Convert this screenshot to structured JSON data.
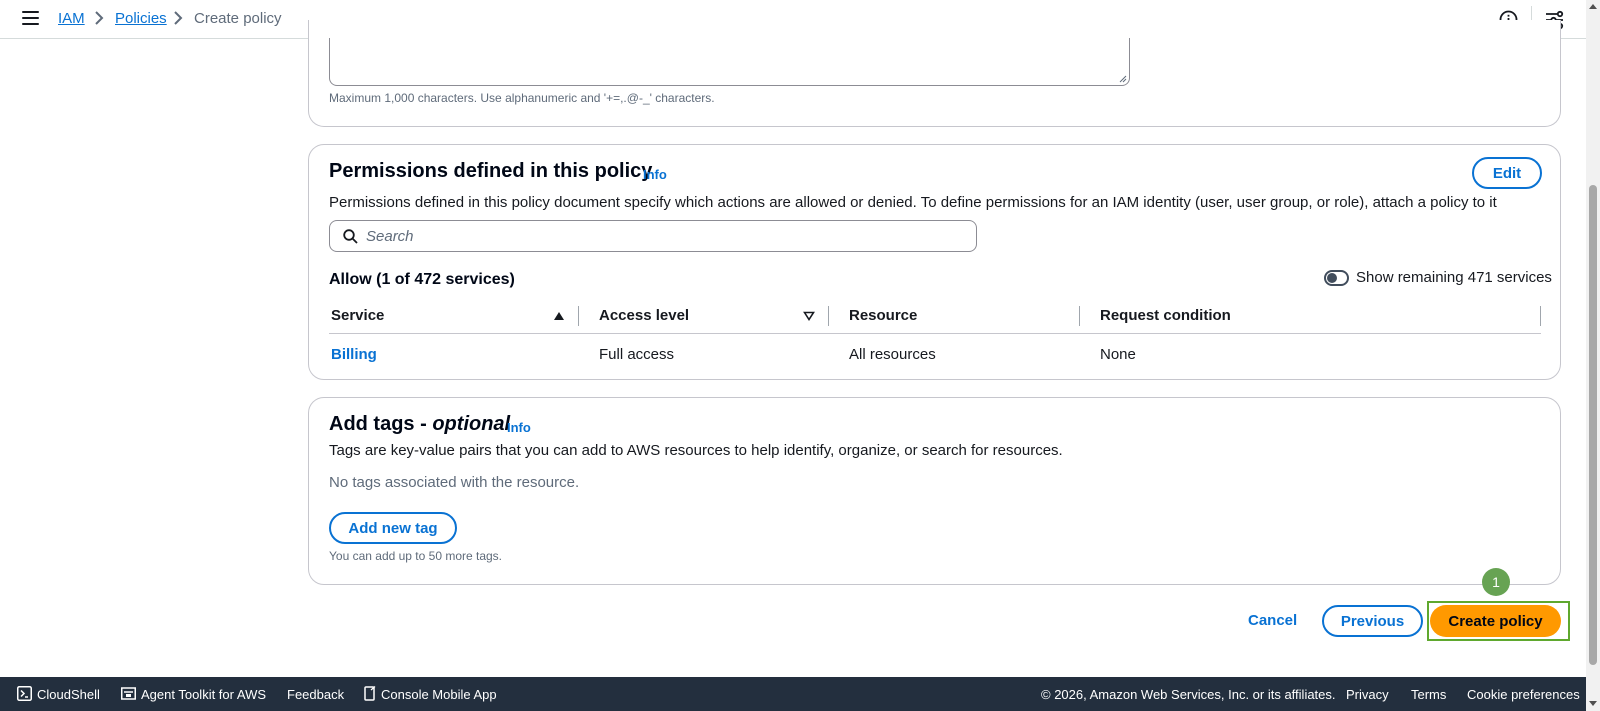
{
  "breadcrumb": {
    "items": [
      "IAM",
      "Policies"
    ],
    "current": "Create policy"
  },
  "description_card": {
    "hint": "Maximum 1,000 characters. Use alphanumeric and '+=,.@-_' characters."
  },
  "permissions": {
    "title": "Permissions defined in this policy",
    "info": "Info",
    "edit_label": "Edit",
    "description": "Permissions defined in this policy document specify which actions are allowed or denied. To define permissions for an IAM identity (user, user group, or role), attach a policy to it",
    "search_placeholder": "Search",
    "allow_heading": "Allow (1 of 472 services)",
    "toggle_label": "Show remaining 471 services",
    "columns": [
      "Service",
      "Access level",
      "Resource",
      "Request condition"
    ],
    "rows": [
      {
        "service": "Billing",
        "access": "Full access",
        "resource": "All resources",
        "condition": "None"
      }
    ]
  },
  "tags": {
    "title": "Add tags - ",
    "title_optional": "optional",
    "info": "Info",
    "description": "Tags are key-value pairs that you can add to AWS resources to help identify, organize, or search for resources.",
    "empty": "No tags associated with the resource.",
    "add_label": "Add new tag",
    "limit": "You can add up to 50 more tags."
  },
  "actions": {
    "cancel": "Cancel",
    "previous": "Previous",
    "create": "Create policy",
    "badge": "1"
  },
  "footer": {
    "cloudshell": "CloudShell",
    "agent_toolkit": "Agent Toolkit for AWS",
    "feedback": "Feedback",
    "mobile_app": "Console Mobile App",
    "copyright": "© 2026, Amazon Web Services, Inc. or its affiliates.",
    "privacy": "Privacy",
    "terms": "Terms",
    "cookies": "Cookie preferences"
  },
  "colors": {
    "link": "#0972d3",
    "primary_button": "#ff9900",
    "footer_bg": "#232f3e",
    "highlight": "#5fa82e"
  }
}
